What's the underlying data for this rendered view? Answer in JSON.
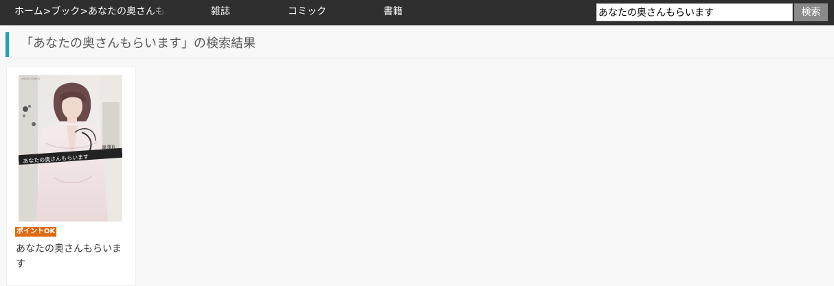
{
  "breadcrumb": {
    "home": "ホーム",
    "sep1": ">",
    "books": "ブック",
    "sep2": ">",
    "current": "あなたの奥さんもらいます"
  },
  "nav": {
    "magazine": "雑誌",
    "comic": "コミック",
    "books": "書籍"
  },
  "search": {
    "value": "あなたの奥さんもらいます",
    "button_label": "検索"
  },
  "results": {
    "heading": "「あなたの奥さんもらいます」の検索結果",
    "items": [
      {
        "badge": "ポイントOK",
        "title": "あなたの奥さんもらいます",
        "cover_label_publisher": "ANGEL COMICS",
        "cover_label_title": "あなたの奥さんもらいます",
        "cover_label_author": "黒澤R"
      }
    ]
  },
  "colors": {
    "topbar": "#2f2f2f",
    "accent": "#1fa2b1",
    "badge": "#e06a12",
    "search_button": "#8a8a8a"
  }
}
